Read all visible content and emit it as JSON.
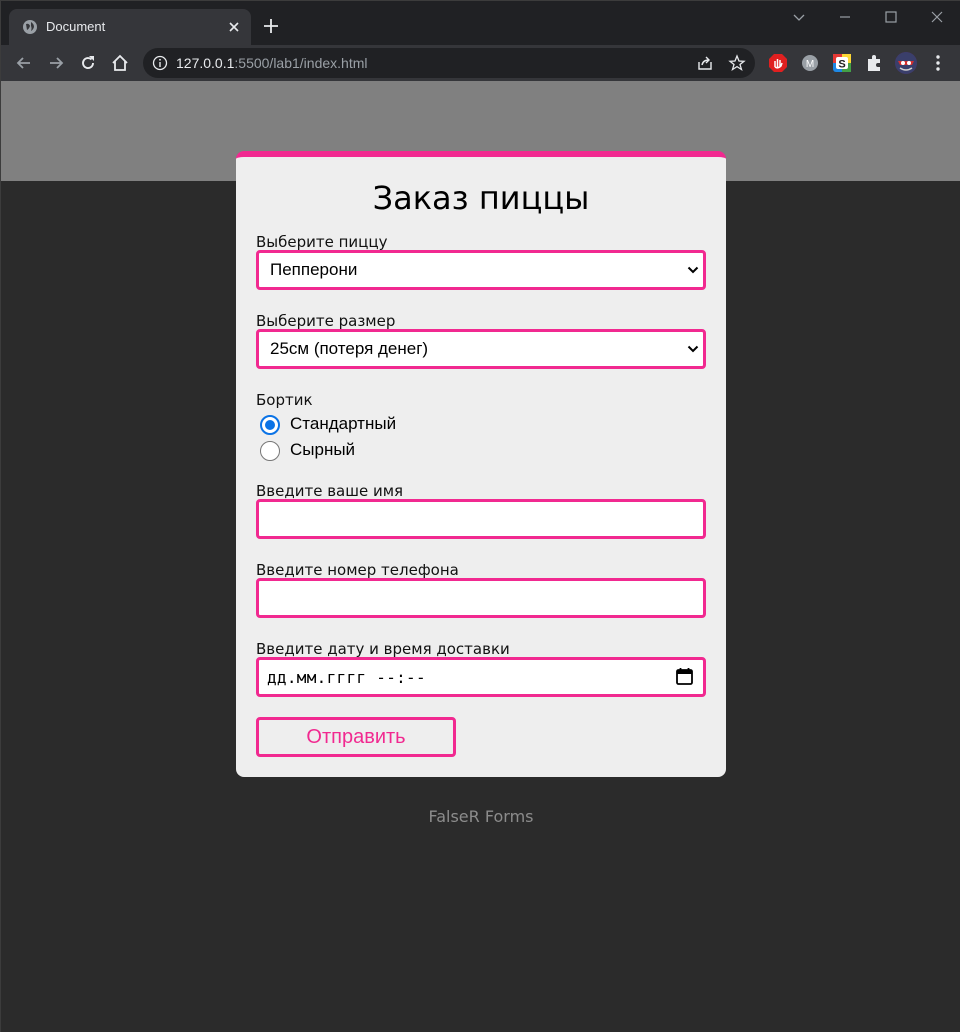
{
  "browser": {
    "tab_title": "Document",
    "url_host": "127.0.0.1",
    "url_rest": ":5500/lab1/index.html"
  },
  "form": {
    "title": "Заказ пиццы",
    "pizza_label": "Выберите пиццу",
    "pizza_value": "Пепперони",
    "size_label": "Выберите размер",
    "size_value": "25см (потеря денег)",
    "crust_label": "Бортик",
    "crust_options": [
      {
        "label": "Стандартный",
        "checked": true
      },
      {
        "label": "Сырный",
        "checked": false
      }
    ],
    "name_label": "Введите ваше имя",
    "name_value": "",
    "phone_label": "Введите номер телефона",
    "phone_value": "",
    "datetime_label": "Введите дату и время доставки",
    "datetime_placeholder": "дд.мм.гггг --:--",
    "submit_label": "Отправить"
  },
  "footer": {
    "text": "FalseR Forms"
  },
  "colors": {
    "accent": "#f12990",
    "card_bg": "#eeeeee",
    "page_bg": "#2b2b2b",
    "hero_bg": "#808080",
    "radio_checked": "#0b73e6"
  },
  "icons": [
    "globe-icon",
    "close-icon",
    "plus-icon",
    "chevron-down-icon",
    "minimize-icon",
    "maximize-icon",
    "back-icon",
    "forward-icon",
    "reload-icon",
    "home-icon",
    "info-icon",
    "share-icon",
    "star-icon",
    "extension-icon",
    "calendar-icon"
  ]
}
